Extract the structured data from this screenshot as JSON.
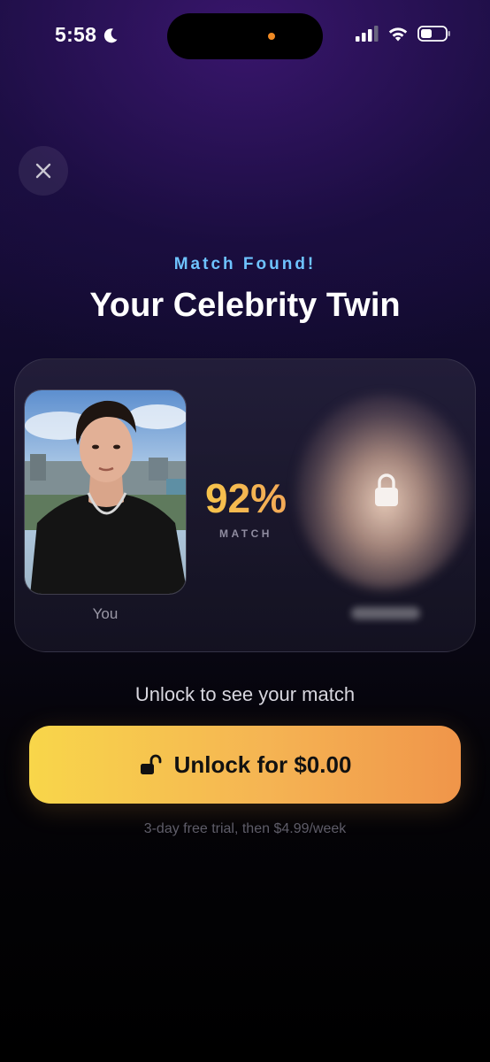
{
  "status_bar": {
    "time": "5:58",
    "icons": [
      "moon-icon",
      "signal-icon",
      "wifi-icon",
      "battery-icon"
    ]
  },
  "header": {
    "eyebrow": "Match Found!",
    "title": "Your Celebrity Twin"
  },
  "match_card": {
    "user_caption": "You",
    "match_percent": "92%",
    "match_label": "MATCH",
    "celebrity_locked": true
  },
  "cta": {
    "hint": "Unlock to see your match",
    "button_label": "Unlock for $0.00",
    "trial_note": "3-day free trial, then $4.99/week"
  },
  "colors": {
    "eyebrow": "#6ec3ff",
    "button_start": "#f8d64a",
    "button_end": "#f0954a",
    "percent": "#f7c948"
  }
}
